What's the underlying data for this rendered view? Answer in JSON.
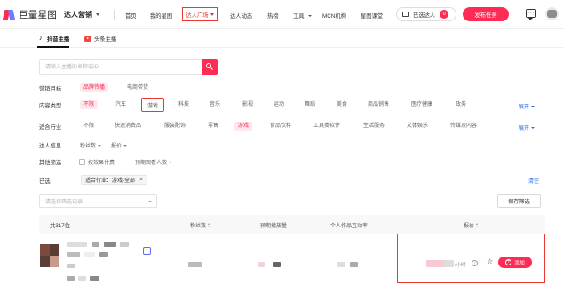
{
  "brand": {
    "logo_text": "巨量星图"
  },
  "header": {
    "app_switch": "达人营销",
    "nav": [
      "首页",
      "我的星图",
      "达人广场",
      "达人动态",
      "热榜",
      "工具",
      "MCN机构",
      "星图课堂"
    ],
    "active_nav": "达人广场",
    "selected_label": "已选达人",
    "selected_count": "0",
    "publish_label": "发布任务"
  },
  "subtabs": {
    "douyin": "抖音主播",
    "xigua": "头条主播"
  },
  "search": {
    "placeholder": "请输入主播的名称或ID"
  },
  "filters": {
    "goal": {
      "label": "营销目标",
      "options": [
        "品牌传播",
        "电商带货"
      ]
    },
    "content": {
      "label": "内容类型",
      "options": [
        "不限",
        "汽车",
        "游戏",
        "科技",
        "音乐",
        "影视",
        "运动",
        "舞蹈",
        "美食",
        "商品销售",
        "医疗健康",
        "政务"
      ],
      "expand": "展开"
    },
    "industry": {
      "label": "适合行业",
      "options": [
        "不限",
        "快速消费品",
        "服装配饰",
        "零售",
        "游戏",
        "食品饮料",
        "工具类软件",
        "生活服务",
        "文体娱乐",
        "传媒及内容"
      ],
      "expand": "展开"
    },
    "info": {
      "label": "达人信息",
      "fans": "粉丝数",
      "price": "报价"
    },
    "other": {
      "label": "其他筛选",
      "pay_by_effect": "按效果付费",
      "expected_viewers": "预期观看人数"
    },
    "selected": {
      "label": "已选",
      "tag": "适合行业：游戏-全部",
      "clear": "清空"
    }
  },
  "saved": {
    "placeholder": "请选择筛选记录",
    "save_button": "保存筛选"
  },
  "table": {
    "total": "共317位",
    "columns": {
      "fans": "粉丝数",
      "expected_play": "预期播放量",
      "interaction": "个人作品互动率",
      "price": "报价"
    }
  },
  "row": {
    "price_suffix": "/小时",
    "add_label": "添加"
  },
  "colors": {
    "accent": "#fe2c55",
    "highlight": "#e63a2e",
    "link": "#2f6fe6"
  },
  "icons": [
    "tiktok-icon",
    "xigua-icon",
    "search-icon",
    "cart-icon",
    "message-icon",
    "star-icon",
    "info-icon",
    "plus-icon",
    "verified-icon"
  ]
}
